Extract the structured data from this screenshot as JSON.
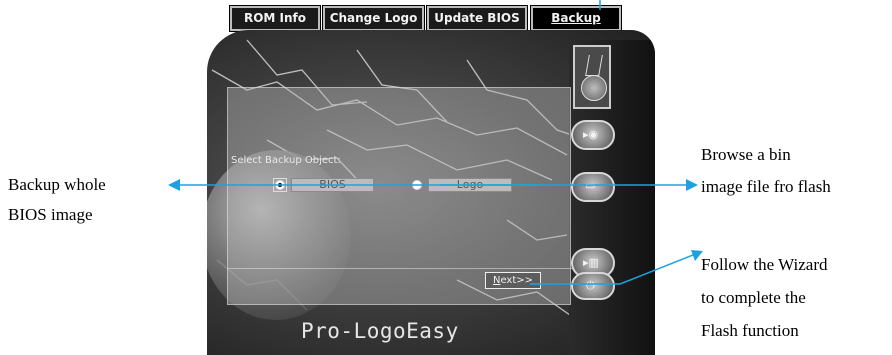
{
  "tabs": [
    {
      "label": "ROM Info",
      "active": false
    },
    {
      "label": "Change Logo",
      "active": false
    },
    {
      "label": "Update BIOS",
      "active": false
    },
    {
      "label": "Backup",
      "active": true
    }
  ],
  "dialog": {
    "select_label": "Select Backup Object:",
    "options": [
      {
        "label": "BIOS",
        "selected": true
      },
      {
        "label": "Logo",
        "selected": false
      }
    ],
    "next_button": {
      "mnemonic": "N",
      "rest": "ext>>"
    }
  },
  "brand": "Pro-LogoEasy",
  "annotations": {
    "backup_whole": [
      "Backup whole",
      "BIOS image"
    ],
    "browse": [
      "Browse a bin",
      "image file fro flash"
    ],
    "wizard": [
      "Follow the Wizard",
      "to complete the",
      "Flash function"
    ]
  },
  "colors": {
    "arrow": "#1aa3e0",
    "tab_bg": "#1b1b1b"
  },
  "icons": {
    "side_buttons": [
      "medal-thumbnail-icon",
      "disk-arrow-icon",
      "monitor-icon",
      "flash-chip-icon",
      "power-icon"
    ]
  }
}
